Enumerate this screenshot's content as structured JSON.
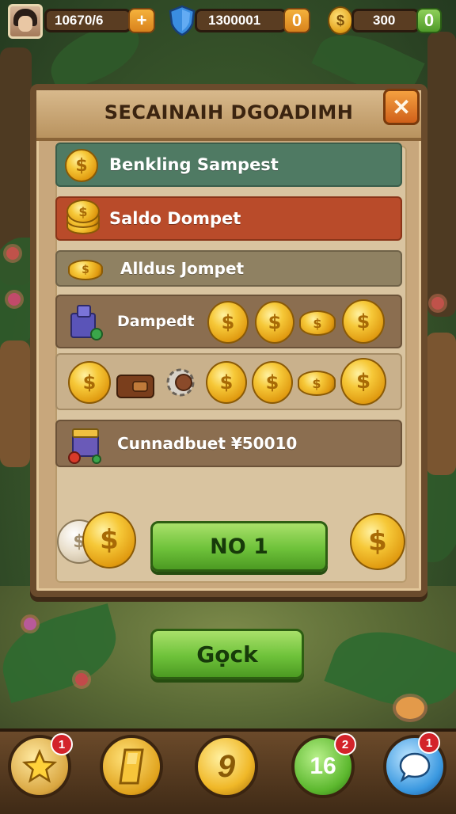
{
  "hud": {
    "resource_1": "10670/6",
    "resource_1_action": "+",
    "resource_2": "1300001",
    "resource_2_action": "0",
    "resource_3": "300",
    "resource_3_action": "0"
  },
  "panel": {
    "title": "SECAINAIH DGOADIMH",
    "close": "✕",
    "rows": [
      {
        "label": "Benkling Sampest",
        "color": "#4f7a63"
      },
      {
        "label": "Saldo Dompet",
        "color": "#b94b2a"
      },
      {
        "label": "Alldus Jompet",
        "color": "#8f8162"
      },
      {
        "label": "Dampedt",
        "color": "#8b6e50"
      },
      {
        "label": "Cunnadbuet ¥50010",
        "color": "#8b6e50"
      }
    ],
    "main_button": "NO  1"
  },
  "back_button": "Gọck",
  "bottom_nav": {
    "btn_1_badge": "1",
    "btn_3_glyph": "9",
    "btn_4_badge": "2",
    "btn_4_glyph": "16",
    "btn_5_badge": "1"
  },
  "coin_symbol": "$"
}
